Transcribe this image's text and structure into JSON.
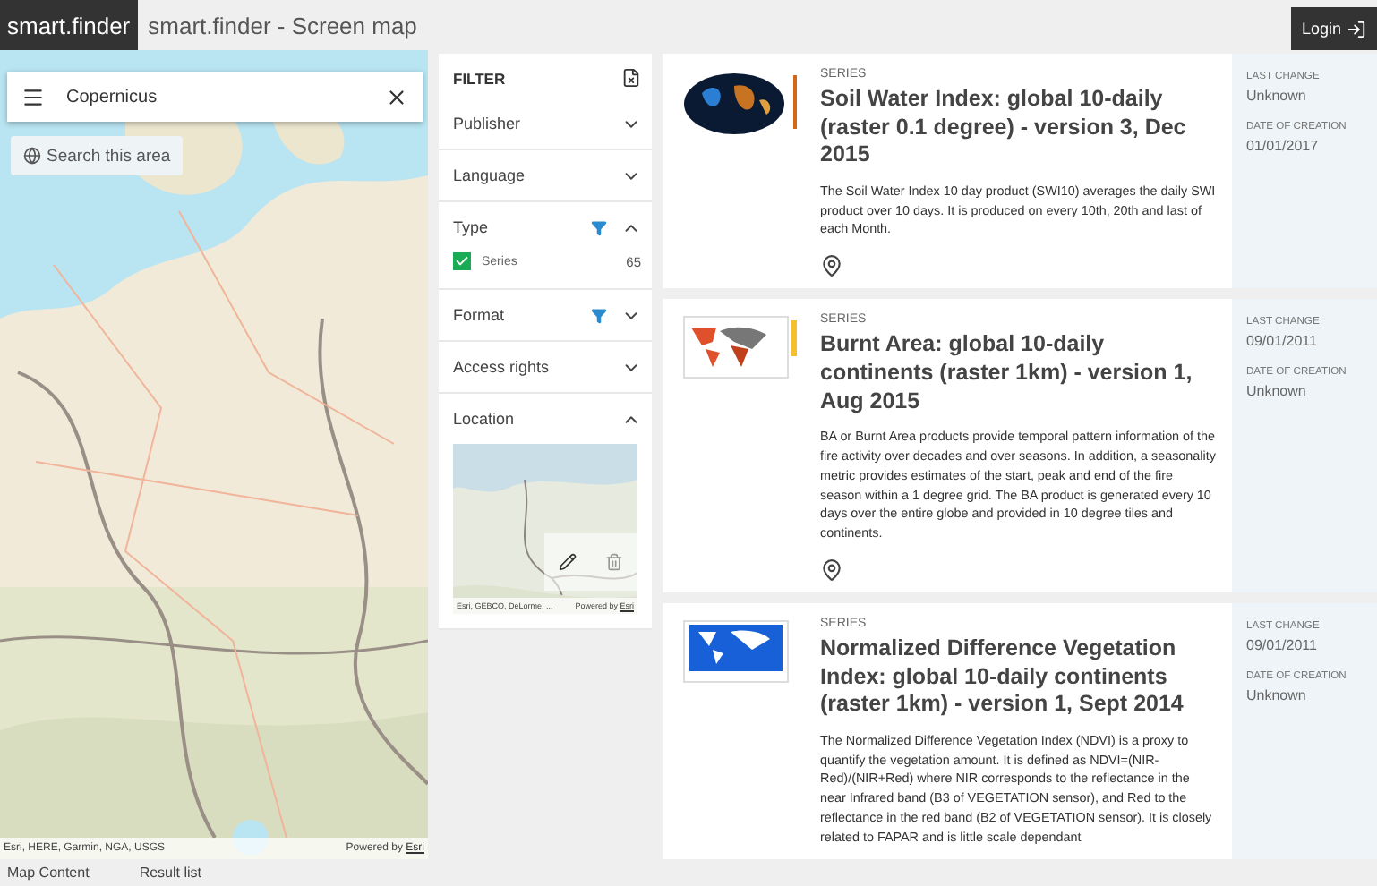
{
  "header": {
    "brand": "smart.finder",
    "title": "smart.finder - Screen map",
    "login": "Login"
  },
  "map": {
    "search_value": "Copernicus",
    "search_area": "Search this area",
    "attribution": "Esri, HERE, Garmin, NGA, USGS",
    "powered_by": "Powered by",
    "powered_link": "Esri"
  },
  "filter": {
    "title": "FILTER",
    "sections": [
      {
        "label": "Publisher",
        "expanded": false,
        "active": false
      },
      {
        "label": "Language",
        "expanded": false,
        "active": false
      },
      {
        "label": "Type",
        "expanded": true,
        "active": true,
        "options": [
          {
            "label": "Series",
            "count": "65",
            "checked": true
          }
        ]
      },
      {
        "label": "Format",
        "expanded": false,
        "active": true
      },
      {
        "label": "Access rights",
        "expanded": false,
        "active": false
      },
      {
        "label": "Location",
        "expanded": true,
        "active": false,
        "map": {
          "attribution": "Esri, GEBCO, DeLorme, ...",
          "powered_by": "Powered by",
          "powered_link": "Esri"
        }
      }
    ]
  },
  "results": [
    {
      "location": true,
      "type": "SERIES",
      "title": "Soil Water Index: global 10-daily (raster 0.1 degree) - version 3, Dec 2015",
      "description": "The Soil Water Index 10 day product (SWI10) averages the daily SWI product over 10 days. It is produced on every 10th, 20th and last of each Month.",
      "meta": [
        {
          "label": "LAST CHANGE",
          "value": "Unknown"
        },
        {
          "label": "DATE OF CREATION",
          "value": "01/01/2017"
        }
      ]
    },
    {
      "location": true,
      "type": "SERIES",
      "title": "Burnt Area: global 10-daily continents (raster 1km) - version 1, Aug 2015",
      "description": "BA or Burnt Area products provide temporal pattern information of the fire activity over decades and over seasons. In addition, a seasonality metric provides estimates of the start, peak and end of the fire season within a 1 degree grid. The BA product is generated every 10 days over the entire globe and provided in 10 degree tiles and continents.",
      "meta": [
        {
          "label": "LAST CHANGE",
          "value": "09/01/2011"
        },
        {
          "label": "DATE OF CREATION",
          "value": "Unknown"
        }
      ]
    },
    {
      "type": "SERIES",
      "title": "Normalized Difference Vegetation Index: global 10-daily continents (raster 1km) - version 1, Sept 2014",
      "description": "The Normalized Difference Vegetation Index (NDVI) is a proxy to quantify the vegetation amount. It is defined as NDVI=(NIR-Red)/(NIR+Red) where NIR corresponds to the reflectance in the near Infrared band (B3 of VEGETATION sensor), and Red to the reflectance in the red band (B2 of VEGETATION sensor). It is closely related to FAPAR and is little scale dependant",
      "meta": [
        {
          "label": "LAST CHANGE",
          "value": "09/01/2011"
        },
        {
          "label": "DATE OF CREATION",
          "value": "Unknown"
        }
      ]
    }
  ],
  "bottom_tabs": [
    "Map Content",
    "Result list"
  ]
}
